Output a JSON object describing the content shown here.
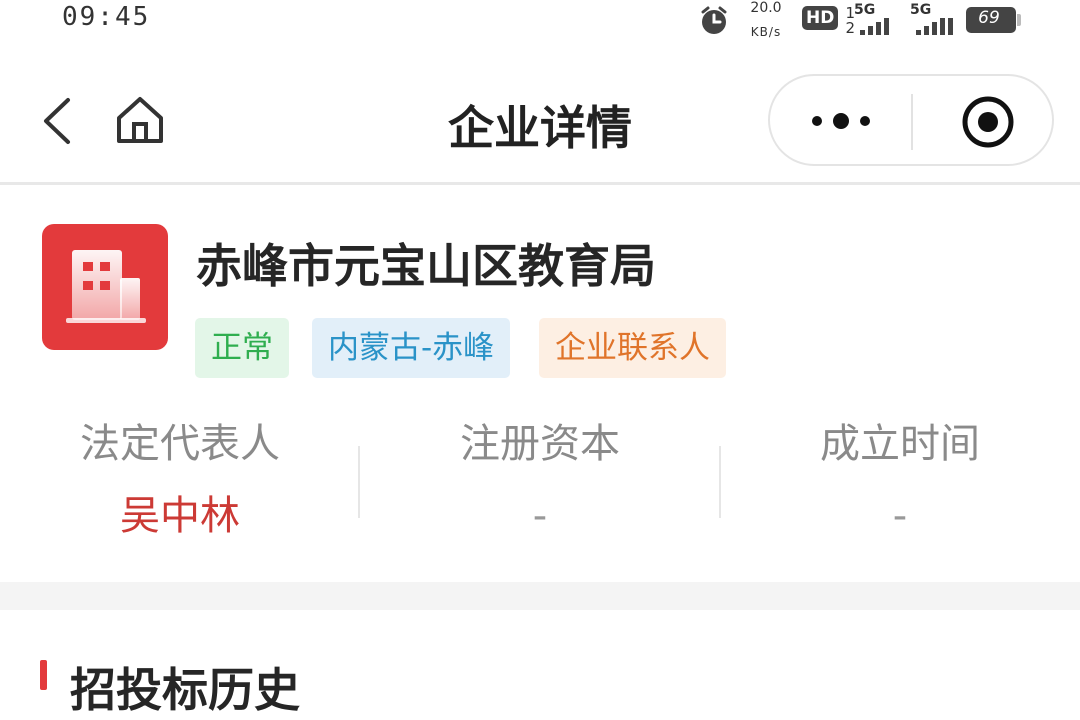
{
  "status_bar": {
    "time": "09:45",
    "net_speed_value": "20.0",
    "net_speed_unit": "KB/s",
    "hd_label": "HD",
    "hd_sub_top": "1",
    "hd_sub_bottom": "2",
    "sim1_label": "5G",
    "sim2_label": "5G",
    "battery_level": "69",
    "icons": [
      "alarm-icon",
      "hd-voice-icon",
      "signal-icon",
      "battery-icon"
    ]
  },
  "nav": {
    "title": "企业详情",
    "icons": [
      "back-icon",
      "home-icon",
      "more-icon",
      "target-icon"
    ]
  },
  "company": {
    "name": "赤峰市元宝山区教育局",
    "logo_icon": "building-icon",
    "logo_color": "#e33a3c",
    "tags": [
      {
        "label": "正常",
        "color": "#2fae4f"
      },
      {
        "label": "内蒙古-赤峰",
        "color": "#2a93c8"
      },
      {
        "label": "企业联系人",
        "color": "#e0742a"
      }
    ],
    "info": [
      {
        "label": "法定代表人",
        "value": "吴中林"
      },
      {
        "label": "注册资本",
        "value": "-"
      },
      {
        "label": "成立时间",
        "value": "-"
      }
    ]
  },
  "section": {
    "title": "招投标历史"
  }
}
